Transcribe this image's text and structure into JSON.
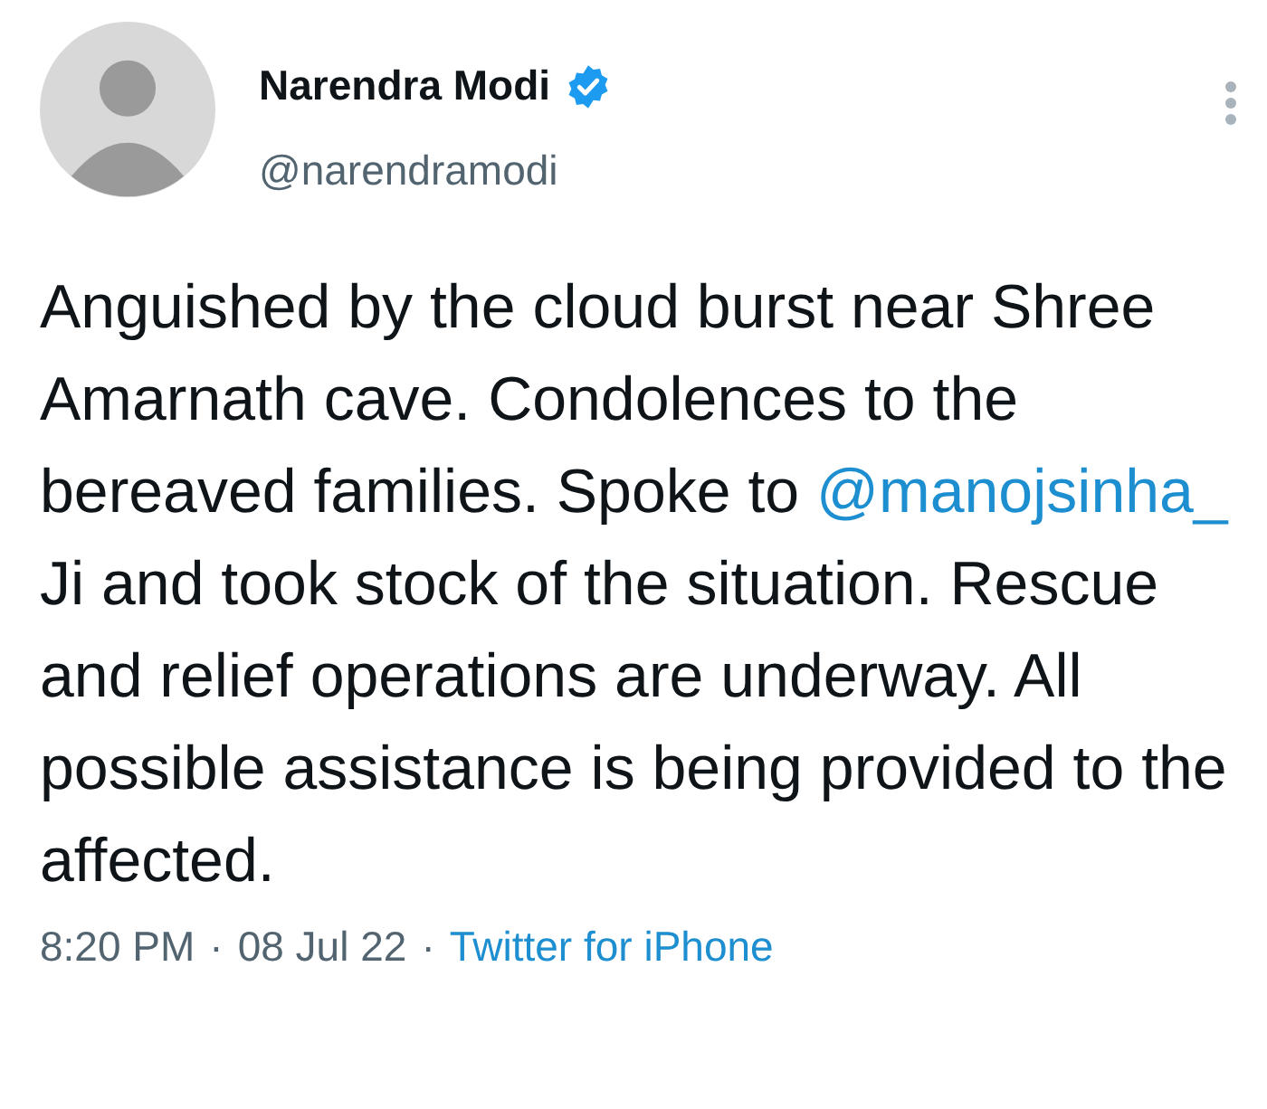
{
  "author": {
    "name": "Narendra Modi",
    "verified": true,
    "handle": "@narendramodi"
  },
  "tweet": {
    "parts": [
      {
        "kind": "text",
        "text": "Anguished by the cloud burst near Shree Amarnath cave. Condolences to the bereaved families. Spoke to "
      },
      {
        "kind": "mention",
        "text": "@manojsinha_"
      },
      {
        "kind": "text",
        "text": " Ji and took stock of the situation. Rescue and relief operations are underway. All possible assistance is being provided to the affected."
      }
    ]
  },
  "meta": {
    "time": "8:20 PM",
    "date": "08 Jul 22",
    "source": "Twitter for iPhone",
    "separator": "·"
  }
}
